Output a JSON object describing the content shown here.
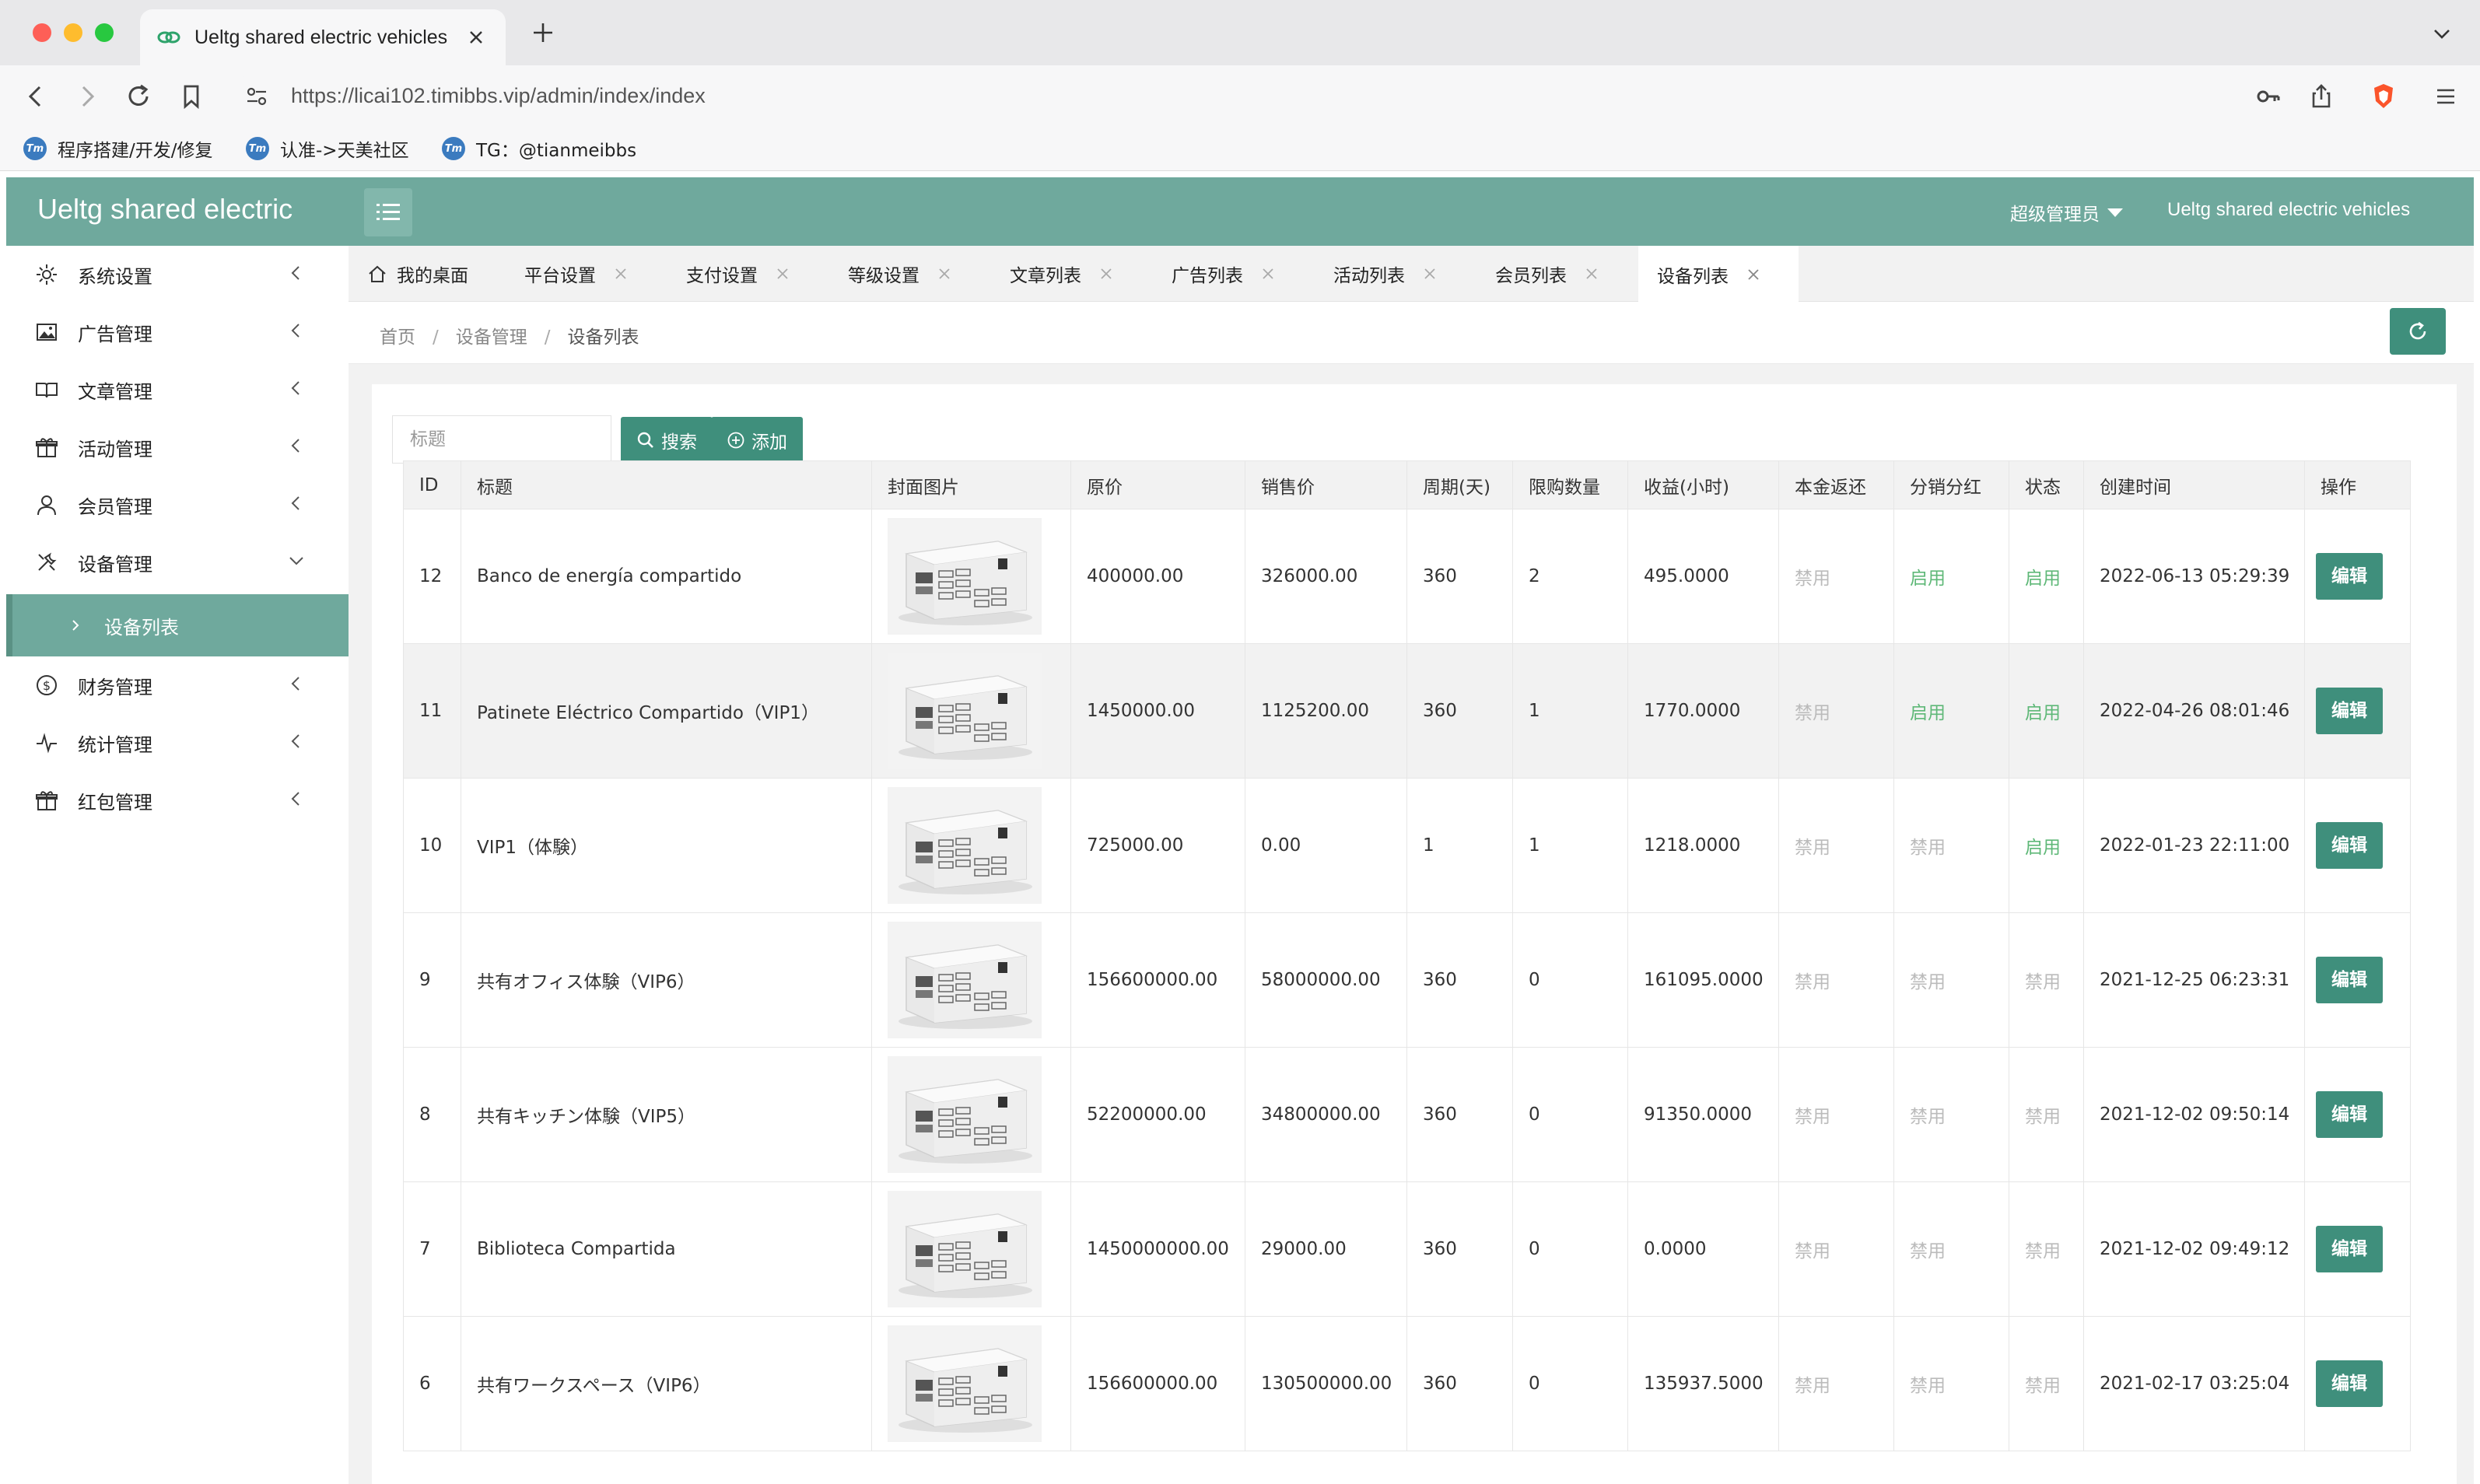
{
  "browser": {
    "tab_title": "Ueltg shared electric vehicles",
    "url_host": "https://licai102.timibbs.vip",
    "url_path": "/admin/index/index",
    "bookmarks": [
      "程序搭建/开发/修复",
      "认准->天美社区",
      "TG：@tianmeibbs"
    ]
  },
  "header": {
    "logo": "Ueltg shared electric",
    "user": "超级管理员",
    "site_name": "Ueltg shared electric vehicles"
  },
  "sidebar": {
    "items": [
      {
        "label": "系统设置",
        "icon": "gear-icon"
      },
      {
        "label": "广告管理",
        "icon": "image-icon"
      },
      {
        "label": "文章管理",
        "icon": "book-icon"
      },
      {
        "label": "活动管理",
        "icon": "gift-icon"
      },
      {
        "label": "会员管理",
        "icon": "user-icon"
      },
      {
        "label": "设备管理",
        "icon": "tools-icon"
      },
      {
        "label": "财务管理",
        "icon": "dollar-icon"
      },
      {
        "label": "统计管理",
        "icon": "pulse-icon"
      },
      {
        "label": "红包管理",
        "icon": "redpacket-icon"
      }
    ],
    "sub_active": "设备列表"
  },
  "page_tabs": [
    "我的桌面",
    "平台设置",
    "支付设置",
    "等级设置",
    "文章列表",
    "广告列表",
    "活动列表",
    "会员列表",
    "设备列表"
  ],
  "breadcrumb": [
    "首页",
    "设备管理",
    "设备列表"
  ],
  "toolbar": {
    "search_placeholder": "标题",
    "search_label": "搜索",
    "add_label": "添加"
  },
  "table": {
    "headers": [
      "ID",
      "标题",
      "封面图片",
      "原价",
      "销售价",
      "周期(天)",
      "限购数量",
      "收益(小时)",
      "本金返还",
      "分销分红",
      "状态",
      "创建时间",
      "操作"
    ],
    "edit_label": "编辑",
    "rows": [
      {
        "id": "12",
        "title": "Banco de energía compartido",
        "price": "400000.00",
        "sale": "326000.00",
        "period": "360",
        "limit": "2",
        "income": "495.0000",
        "refund": "禁用",
        "dist": "启用",
        "status": "启用",
        "created": "2022-06-13 05:29:39"
      },
      {
        "id": "11",
        "title": "Patinete Eléctrico Compartido（VIP1）",
        "price": "1450000.00",
        "sale": "1125200.00",
        "period": "360",
        "limit": "1",
        "income": "1770.0000",
        "refund": "禁用",
        "dist": "启用",
        "status": "启用",
        "created": "2022-04-26 08:01:46"
      },
      {
        "id": "10",
        "title": "VIP1（体験）",
        "price": "725000.00",
        "sale": "0.00",
        "period": "1",
        "limit": "1",
        "income": "1218.0000",
        "refund": "禁用",
        "dist": "禁用",
        "status": "启用",
        "created": "2022-01-23 22:11:00"
      },
      {
        "id": "9",
        "title": "共有オフィス体験（VIP6）",
        "price": "156600000.00",
        "sale": "58000000.00",
        "period": "360",
        "limit": "0",
        "income": "161095.0000",
        "refund": "禁用",
        "dist": "禁用",
        "status": "禁用",
        "created": "2021-12-25 06:23:31"
      },
      {
        "id": "8",
        "title": "共有キッチン体験（VIP5）",
        "price": "52200000.00",
        "sale": "34800000.00",
        "period": "360",
        "limit": "0",
        "income": "91350.0000",
        "refund": "禁用",
        "dist": "禁用",
        "status": "禁用",
        "created": "2021-12-02 09:50:14"
      },
      {
        "id": "7",
        "title": "Biblioteca Compartida",
        "price": "1450000000.00",
        "sale": "29000.00",
        "period": "360",
        "limit": "0",
        "income": "0.0000",
        "refund": "禁用",
        "dist": "禁用",
        "status": "禁用",
        "created": "2021-12-02 09:49:12"
      },
      {
        "id": "6",
        "title": "共有ワークスペース（VIP6）",
        "price": "156600000.00",
        "sale": "130500000.00",
        "period": "360",
        "limit": "0",
        "income": "135937.5000",
        "refund": "禁用",
        "dist": "禁用",
        "status": "禁用",
        "created": "2021-02-17 03:25:04"
      }
    ]
  },
  "colors": {
    "primary": "#6fa99d",
    "button": "#3f8f7c",
    "enabled": "#5fb878",
    "disabled": "#bbbbbb"
  }
}
